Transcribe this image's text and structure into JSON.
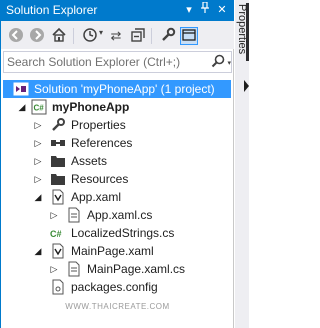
{
  "titlebar": {
    "title": "Solution Explorer",
    "buttons": [
      "dropdown",
      "pin",
      "close"
    ]
  },
  "toolbar": {
    "tools": [
      "back",
      "forward",
      "home",
      "sync-history",
      "refresh",
      "collapse-all",
      "properties",
      "preview-selected"
    ]
  },
  "search": {
    "placeholder": "Search Solution Explorer (Ctrl+;)"
  },
  "tree": {
    "solution": "Solution 'myPhoneApp' (1 project)",
    "project": "myPhoneApp",
    "items": [
      "Properties",
      "References",
      "Assets",
      "Resources",
      "App.xaml",
      "App.xaml.cs",
      "LocalizedStrings.cs",
      "MainPage.xaml",
      "MainPage.xaml.cs",
      "packages.config"
    ]
  },
  "watermark": "WWW.THAICREATE.COM",
  "sidetab": {
    "label": "Properties"
  },
  "colors": {
    "accent": "#007acc",
    "selection": "#3399ff",
    "toolbar_bg": "#eeeef2"
  }
}
